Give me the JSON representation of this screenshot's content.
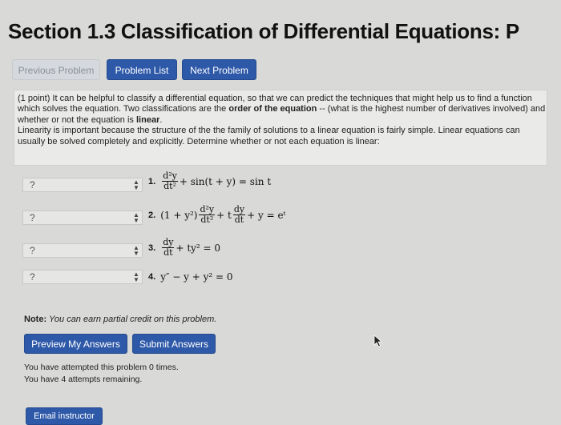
{
  "page": {
    "title": "Section 1.3 Classification of Differential Equations: P"
  },
  "nav": {
    "previous_label": "Previous Problem",
    "list_label": "Problem List",
    "next_label": "Next Problem"
  },
  "problem": {
    "points": "(1 point)",
    "intro": "It can be helpful to classify a differential equation, so that we can predict the techniques that might help us to find a function which solves the equation. Two classifications are the",
    "bold_order": "order of the equation",
    "mid": "-- (what is the highest number of derivatives involved) and whether or not the equation is",
    "bold_linear": "linear",
    "period": ".",
    "line2": "Linearity is important because the structure of the the family of solutions to a linear equation is fairly simple. Linear equations can usually be solved completely and explicitly. Determine whether or not each equation is linear:"
  },
  "questions": [
    {
      "selected": "?",
      "number": "1.",
      "rest": "+ sin(t + y) = sin t"
    },
    {
      "selected": "?",
      "number": "2.",
      "lead": "(1 + y²)",
      "mid": "+ t",
      "rest": "+ y = eᵗ"
    },
    {
      "selected": "?",
      "number": "3.",
      "rest": "+ ty² = 0"
    },
    {
      "selected": "?",
      "number": "4.",
      "text": "y″ − y + y² = 0"
    }
  ],
  "fractions": {
    "d2y": "d²y",
    "dt2": "dt²",
    "dy": "dy",
    "dt": "dt"
  },
  "note": {
    "label": "Note:",
    "text": "You can earn partial credit on this problem."
  },
  "actions": {
    "preview_label": "Preview My Answers",
    "submit_label": "Submit Answers",
    "email_label": "Email instructor"
  },
  "status": {
    "attempted": "You have attempted this problem 0 times.",
    "remaining": "You have 4 attempts remaining."
  },
  "colors": {
    "primary": "#2e59a8",
    "background": "#d9d9d7"
  }
}
